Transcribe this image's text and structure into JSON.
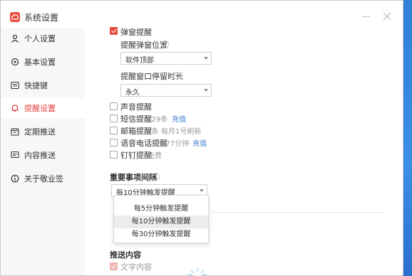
{
  "window": {
    "title": "系统设置"
  },
  "sidebar": {
    "items": [
      {
        "label": "个人设置",
        "icon": "user-icon"
      },
      {
        "label": "基本设置",
        "icon": "settings-icon"
      },
      {
        "label": "快捷键",
        "icon": "keyboard-icon"
      },
      {
        "label": "提醒设置",
        "icon": "bell-icon",
        "active": true
      },
      {
        "label": "定期推送",
        "icon": "calendar-icon"
      },
      {
        "label": "内容推送",
        "icon": "message-icon"
      },
      {
        "label": "关于敬业签",
        "icon": "info-icon"
      }
    ]
  },
  "popup": {
    "label": "弹窗提醒",
    "position_label": "提醒弹窗位置",
    "position_value": "软件顶部",
    "duration_label": "提醒窗口停留时长",
    "duration_value": "永久"
  },
  "options": {
    "sound": "声音提醒",
    "sms": "短信提醒",
    "sms_count": "129条",
    "sms_recharge": "充值",
    "email": "邮箱提醒",
    "email_count": "0条",
    "email_note": "每月1号刷新",
    "voice": "语音电话提醒",
    "voice_count": "9.77分钟",
    "voice_recharge": "充值",
    "dingding": "钉钉提醒",
    "dingding_note": "免费"
  },
  "important": {
    "label": "重要事项间隔",
    "value": "每10分钟触发提醒",
    "dropdown": [
      "每5分钟触发提醒",
      "每10分钟触发提醒",
      "每30分钟触发提醒"
    ]
  },
  "push": {
    "title": "推送内容",
    "text_content": "文字内容"
  },
  "colors": {
    "accent": "#e84b3c",
    "link": "#3a7bd5"
  }
}
